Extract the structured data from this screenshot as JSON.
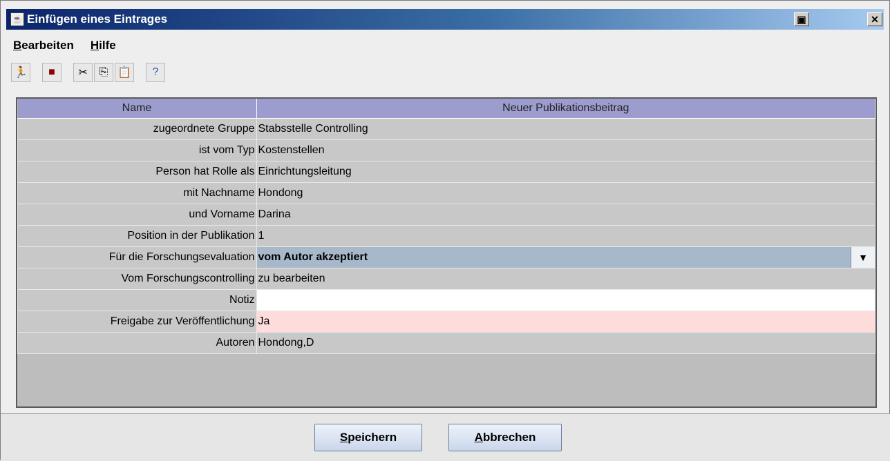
{
  "window": {
    "title": "Einfügen eines Eintrages",
    "icons": [
      "java-app-icon",
      "restore-icon",
      "close-icon"
    ]
  },
  "menu": [
    {
      "label_first": "B",
      "label_rest": "earbeiten"
    },
    {
      "label_first": "H",
      "label_rest": "ilfe"
    }
  ],
  "toolbar": {
    "icons": [
      "exit-icon",
      "save-icon",
      "cut-icon",
      "copy-icon",
      "paste-icon",
      "help-icon"
    ]
  },
  "table": {
    "headers": [
      "Name",
      "Neuer Publikationsbeitrag"
    ],
    "rows": [
      {
        "key": "zugeordnete Gruppe",
        "value": "Stabsstelle Controlling"
      },
      {
        "key": "ist vom Typ",
        "value": "Kostenstellen"
      },
      {
        "key": "Person hat Rolle als",
        "value": "Einrichtungsleitung"
      },
      {
        "key": "mit Nachname",
        "value": "Hondong"
      },
      {
        "key": "und Vorname",
        "value": "Darina"
      },
      {
        "key": "Position in der Publikation",
        "value": "1"
      },
      {
        "key": "Für die Forschungsevaluation",
        "value": "vom Autor akzeptiert"
      },
      {
        "key": "Vom Forschungscontrolling",
        "value": "zu bearbeiten"
      },
      {
        "key": "Notiz",
        "value": ""
      },
      {
        "key": "Freigabe zur Veröffentlichung",
        "value": "Ja"
      },
      {
        "key": "Autoren",
        "value": "Hondong,D"
      }
    ]
  },
  "buttons": {
    "save_first": "S",
    "save_rest": "peichern",
    "cancel_first": "A",
    "cancel_rest": "bbrechen"
  },
  "colors": {
    "header": "#9c9ccf",
    "dropdown_selected": "#a6b8c9",
    "notiz_field": "#ffffff",
    "freigabe_field": "#ffdcdc"
  }
}
